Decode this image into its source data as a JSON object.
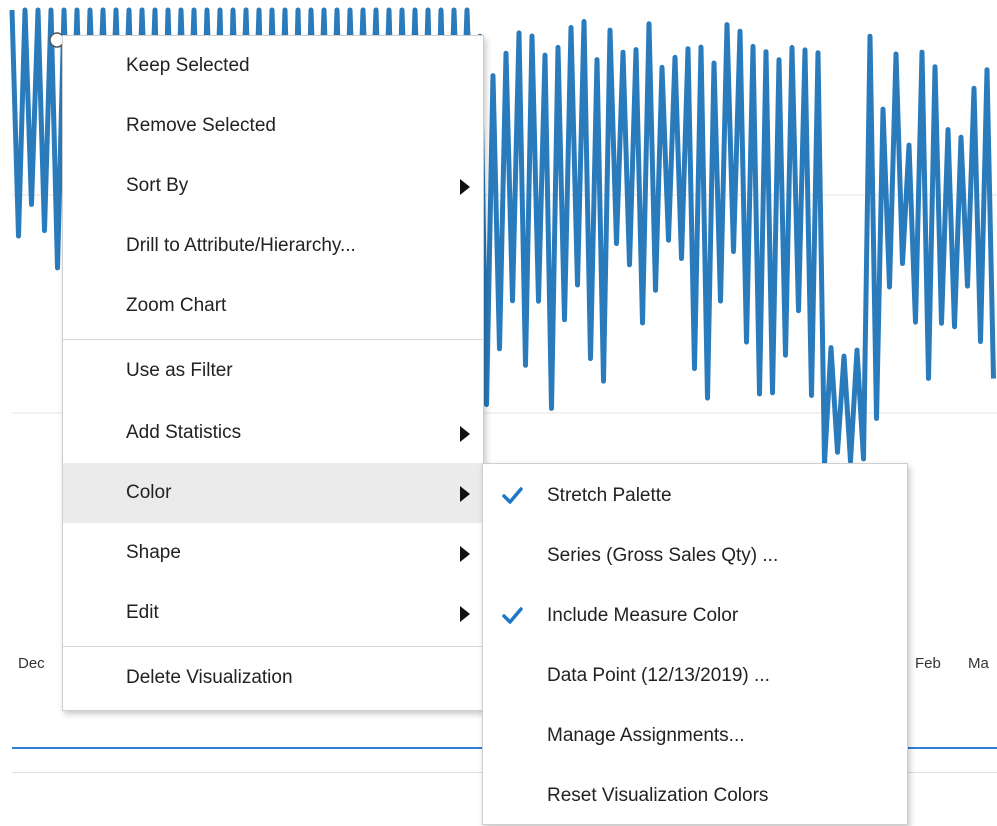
{
  "chart": {
    "x_ticks": [
      "Dec",
      "Feb",
      "Ma"
    ],
    "series_color": "#2a7bbc"
  },
  "context_menu": {
    "items": [
      {
        "label": "Keep Selected",
        "submenu": false
      },
      {
        "label": "Remove Selected",
        "submenu": false
      },
      {
        "label": "Sort By",
        "submenu": true
      },
      {
        "label": "Drill to Attribute/Hierarchy...",
        "submenu": false
      },
      {
        "label": "Zoom Chart",
        "submenu": false
      },
      {
        "label": "Use as Filter",
        "submenu": false
      },
      {
        "label": "Add Statistics",
        "submenu": true
      },
      {
        "label": "Color",
        "submenu": true,
        "highlighted": true
      },
      {
        "label": "Shape",
        "submenu": true
      },
      {
        "label": "Edit",
        "submenu": true
      },
      {
        "label": "Delete Visualization",
        "submenu": false
      }
    ]
  },
  "color_submenu": {
    "check_color": "#1f77c9",
    "items": [
      {
        "label": "Stretch Palette",
        "checked": true
      },
      {
        "label": "Series (Gross Sales Qty) ...",
        "checked": false
      },
      {
        "label": "Include Measure Color",
        "checked": true
      },
      {
        "label": "Data Point (12/13/2019) ...",
        "checked": false
      },
      {
        "label": "Manage Assignments...",
        "checked": false
      },
      {
        "label": "Reset Visualization Colors",
        "checked": false
      }
    ]
  }
}
